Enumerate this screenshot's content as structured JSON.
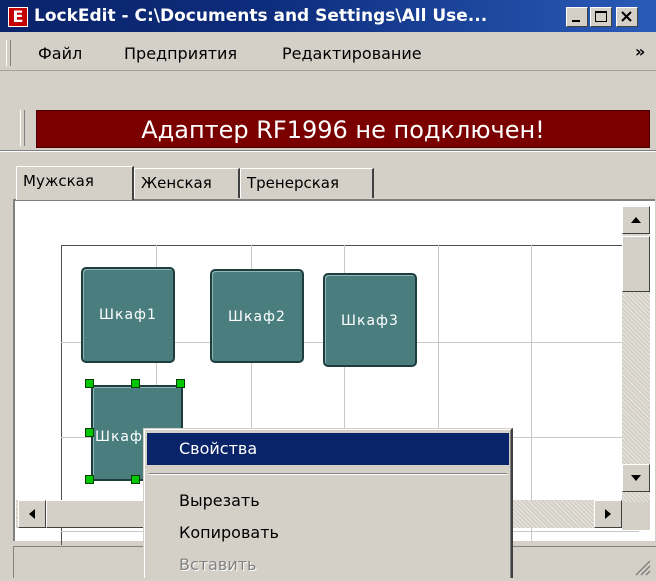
{
  "window": {
    "title": "LockEdit - C:\\Documents and Settings\\All Use...",
    "icon_letter": "E"
  },
  "menu": {
    "items": [
      "Файл",
      "Предприятия",
      "Редактирование"
    ],
    "overflow": "»"
  },
  "banner": {
    "text": "Адаптер RF1996 не подключен!",
    "color": "#7a0000"
  },
  "tabs": [
    {
      "label": "Мужская",
      "active": true
    },
    {
      "label": "Женская",
      "active": false
    },
    {
      "label": "Тренерская",
      "active": false
    }
  ],
  "cabinets": [
    {
      "label": "Шкаф1"
    },
    {
      "label": "Шкаф2"
    },
    {
      "label": "Шкаф3"
    },
    {
      "label": "Шкаф4",
      "selected": true
    }
  ],
  "context_menu": {
    "items": [
      {
        "label": "Свойства",
        "state": "highlighted"
      },
      {
        "label": "Вырезать",
        "state": "enabled"
      },
      {
        "label": "Копировать",
        "state": "enabled"
      },
      {
        "label": "Вставить",
        "state": "disabled"
      }
    ]
  },
  "colors": {
    "cabinet_fill": "#4a7e7e",
    "selection_handle": "#00c800",
    "menu_highlight": "#0a246a"
  }
}
